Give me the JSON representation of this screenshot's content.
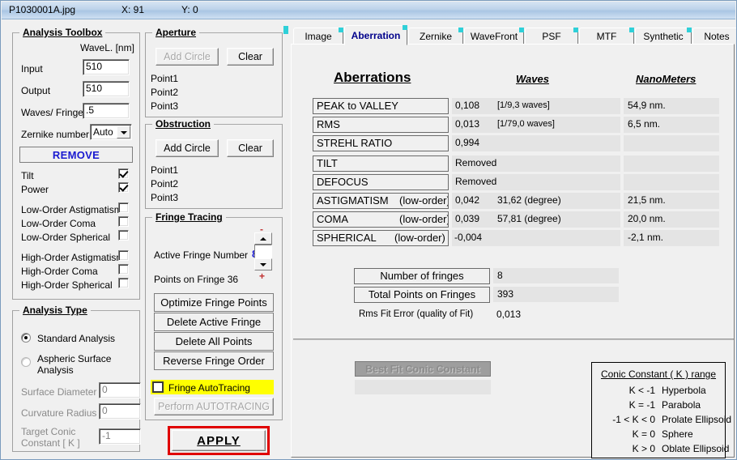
{
  "window": {
    "filename": "P1030001A.jpg",
    "coord_x": "X: 91",
    "coord_y": "Y: 0"
  },
  "analysis_toolbox": {
    "title": "Analysis Toolbox",
    "wavelength_header": "WaveL. [nm]",
    "input_label": "Input",
    "input_value": "510",
    "output_label": "Output",
    "output_value": "510",
    "waves_fringe_label": "Waves/ Fringe",
    "waves_fringe_value": ".5",
    "zernike_label": "Zernike number",
    "zernike_value": "Auto",
    "remove_button": "REMOVE",
    "checkboxes": [
      {
        "label": "Tilt",
        "checked": true
      },
      {
        "label": "Power",
        "checked": true
      },
      {
        "label": "Low-Order  Astigmatism",
        "checked": false
      },
      {
        "label": "Low-Order  Coma",
        "checked": false
      },
      {
        "label": "Low-Order  Spherical",
        "checked": false
      },
      {
        "label": "High-Order  Astigmatism",
        "checked": false
      },
      {
        "label": "High-Order  Coma",
        "checked": false
      },
      {
        "label": "High-Order  Spherical",
        "checked": false
      }
    ]
  },
  "analysis_type": {
    "title": "Analysis Type",
    "option_standard": "Standard  Analysis",
    "option_aspheric_line1": "Aspheric  Surface",
    "option_aspheric_line2": "Analysis",
    "surface_diameter_label": "Surface Diameter",
    "surface_diameter_value": "0",
    "curvature_radius_label": "Curvature Radius",
    "curvature_radius_value": "0",
    "target_conic_label_line1": "Target Conic",
    "target_conic_label_line2": "Constant [ K ]",
    "target_conic_value": "-1"
  },
  "aperture": {
    "title": "Aperture",
    "add_circle": "Add Circle",
    "add_circle_disabled": true,
    "clear": "Clear",
    "points": [
      "Point1",
      "Point2",
      "Point3"
    ]
  },
  "obstruction": {
    "title": "Obstruction",
    "add_circle": "Add Circle",
    "add_circle_disabled": false,
    "clear": "Clear",
    "points": [
      "Point1",
      "Point2",
      "Point3"
    ]
  },
  "fringe_tracing": {
    "title": "Fringe Tracing",
    "active_fringe_label": "Active Fringe Number",
    "active_fringe_value": "8",
    "points_on_fringe_label": "Points on  Fringe  36",
    "minus_glyph": "-",
    "plus_glyph": "+",
    "buttons": [
      "Optimize Fringe Points",
      "Delete Active Fringe",
      "Delete  All  Points",
      "Reverse  Fringe Order"
    ],
    "autotracing_label": "Fringe AutoTracing",
    "autotracing_checked": false,
    "perform_autotracing": "Perform  AUTOTRACING",
    "perform_disabled": true
  },
  "apply_button": "APPLY",
  "tabs": [
    {
      "label": "Image",
      "active": false
    },
    {
      "label": "Aberration",
      "active": true
    },
    {
      "label": "Zernike",
      "active": false
    },
    {
      "label": "WaveFront",
      "active": false
    },
    {
      "label": "PSF",
      "active": false
    },
    {
      "label": "MTF",
      "active": false
    },
    {
      "label": "Synthetic",
      "active": false
    },
    {
      "label": "Notes",
      "active": false
    }
  ],
  "aberration_panel": {
    "heading": "Aberrations ",
    "col_waves": "Waves",
    "col_nanometers": "NanoMeters",
    "rows": [
      {
        "name": "PEAK to VALLEY",
        "suffix": "",
        "highlight": "yellow",
        "value": "0,108",
        "extra": "[1/9,3 waves]",
        "nm": "54,9  nm."
      },
      {
        "name": "RMS",
        "suffix": "",
        "highlight": "yellow",
        "value": "0,013",
        "extra": "[1/79,0 waves]",
        "nm": "6,5  nm."
      },
      {
        "name": "STREHL   RATIO",
        "suffix": "",
        "highlight": "yellow",
        "value": "0,994",
        "extra": "",
        "nm": ""
      },
      {
        "name": "TILT",
        "suffix": "",
        "highlight": "none",
        "value": "Removed",
        "extra": "",
        "nm": ""
      },
      {
        "name": "DEFOCUS",
        "suffix": "",
        "highlight": "none",
        "value": "Removed",
        "extra": "",
        "nm": ""
      },
      {
        "name": "ASTIGMATISM",
        "suffix": "(low-order)",
        "highlight": "none",
        "value": "0,042",
        "extra": "31,62  (degree)",
        "nm": "21,5  nm."
      },
      {
        "name": "COMA",
        "suffix": "(low-order)",
        "highlight": "none",
        "value": "0,039",
        "extra": "57,81  (degree)",
        "nm": "20,0  nm."
      },
      {
        "name": "SPHERICAL",
        "suffix": "(low-order)",
        "highlight": "none",
        "value": "-0,004",
        "extra": "",
        "nm": "-2,1  nm."
      }
    ],
    "number_of_fringes_label": "Number of fringes",
    "number_of_fringes_value": "8",
    "total_points_label": "Total  Points on Fringes",
    "total_points_value": "393",
    "rms_fit_label": "Rms Fit Error (quality of Fit)",
    "rms_fit_value": "0,013",
    "best_fit_conic_button": "Best Fit Conic Constant",
    "best_fit_conic_disabled": true,
    "conic_legend": {
      "title": "Conic Constant ( K )  range",
      "entries": [
        {
          "k": "K < -1",
          "shape": "Hyperbola"
        },
        {
          "k": "K = -1",
          "shape": "Parabola"
        },
        {
          "k": "-1 < K < 0",
          "shape": "Prolate Ellipsoid"
        },
        {
          "k": "K =  0",
          "shape": "Sphere"
        },
        {
          "k": "K > 0",
          "shape": "Oblate Ellipsoid"
        }
      ]
    }
  },
  "colors": {
    "highlight_yellow": "#ffff00",
    "highlight_light_yellow": "#ffffc0",
    "accent_blue": "#00008b",
    "apply_frame_red": "#e00000",
    "titlebar_blue": "#bdd3ea"
  }
}
